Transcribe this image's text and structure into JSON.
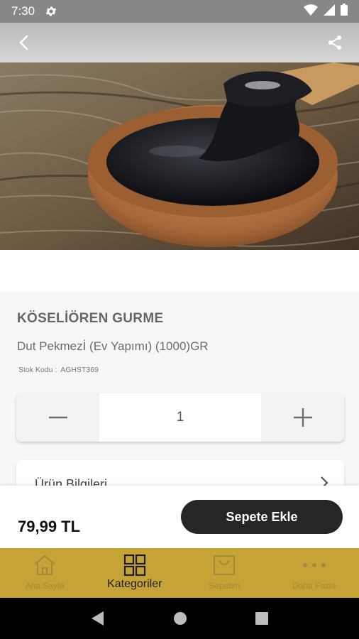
{
  "status_bar": {
    "time": "7:30"
  },
  "product": {
    "brand": "KÖSELİÖREN GURME",
    "name": "Dut Pekmezİ (Ev Yapımı) (1000)GR",
    "sku_label": "Stok Kodu :",
    "sku_value": "AGHST369",
    "quantity": "1"
  },
  "info_section": {
    "label": "Ürün Bilgileri"
  },
  "purchase": {
    "price": "79,99 TL",
    "add_to_cart": "Sepete Ekle"
  },
  "bottom_nav": {
    "items": [
      {
        "label": "Ana Sayfa",
        "icon": "home-icon",
        "active": false
      },
      {
        "label": "Kategoriler",
        "icon": "grid-icon",
        "active": true
      },
      {
        "label": "Sepetim",
        "icon": "cart-icon",
        "active": false
      },
      {
        "label": "Daha Fazla",
        "icon": "more-icon",
        "active": false
      }
    ]
  },
  "colors": {
    "nav_bg": "#c6a335",
    "button_bg": "#262626",
    "status_bg": "#878787"
  }
}
